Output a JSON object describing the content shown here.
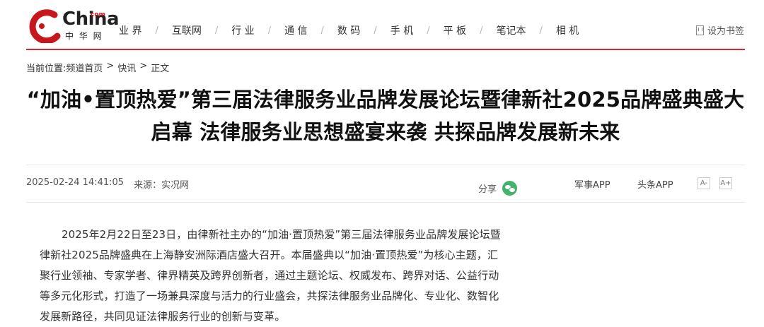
{
  "logo": {
    "text": "China",
    "com": "com",
    "cn": "中 华 网",
    "brand_color": "#c8161d"
  },
  "nav": [
    {
      "label": "业 界"
    },
    {
      "label": "互联网"
    },
    {
      "label": "行 业"
    },
    {
      "label": "通 信"
    },
    {
      "label": "数 码"
    },
    {
      "label": "手 机"
    },
    {
      "label": "平 板"
    },
    {
      "label": "笔记本"
    },
    {
      "label": "相 机"
    }
  ],
  "nav_separator": "/",
  "bookmark": {
    "label": "设为书签"
  },
  "breadcrumb": {
    "prefix": "当前位置:",
    "items": [
      "频道首页",
      "快讯",
      "正文"
    ],
    "separator": ">"
  },
  "article": {
    "title": "“加油•置顶热爱”第三届法律服务业品牌发展论坛暨律新社2025品牌盛典盛大启幕 法律服务业思想盛宴来袭 共探品牌发展新未来",
    "datetime": "2025-02-24 14:41:05",
    "source": "来源：实况网",
    "body": "2025年2月22日至23日，由律新社主办的“加油·置顶热爱”第三届法律服务业品牌发展论坛暨律新社2025品牌盛典在上海静安洲际酒店盛大召开。本届盛典以“加油·置顶热爱”为核心主题，汇聚行业领袖、专家学者、律界精英及跨界创新者，通过主题论坛、权威发布、跨界对话、公益行动等多元化形式，打造了一场兼具深度与活力的行业盛会，共探法律服务业品牌化、专业化、数智化发展新路径，共同见证法律服务行业的创新与变革。"
  },
  "share": {
    "label": "分享",
    "icon": "wechat-icon",
    "color": "#43b26b"
  },
  "apps": {
    "app1": "军事APP",
    "app2": "头条APP"
  },
  "font_controls": {
    "decrease": "A-",
    "increase": "A+"
  },
  "accent_color": "#d9282d"
}
